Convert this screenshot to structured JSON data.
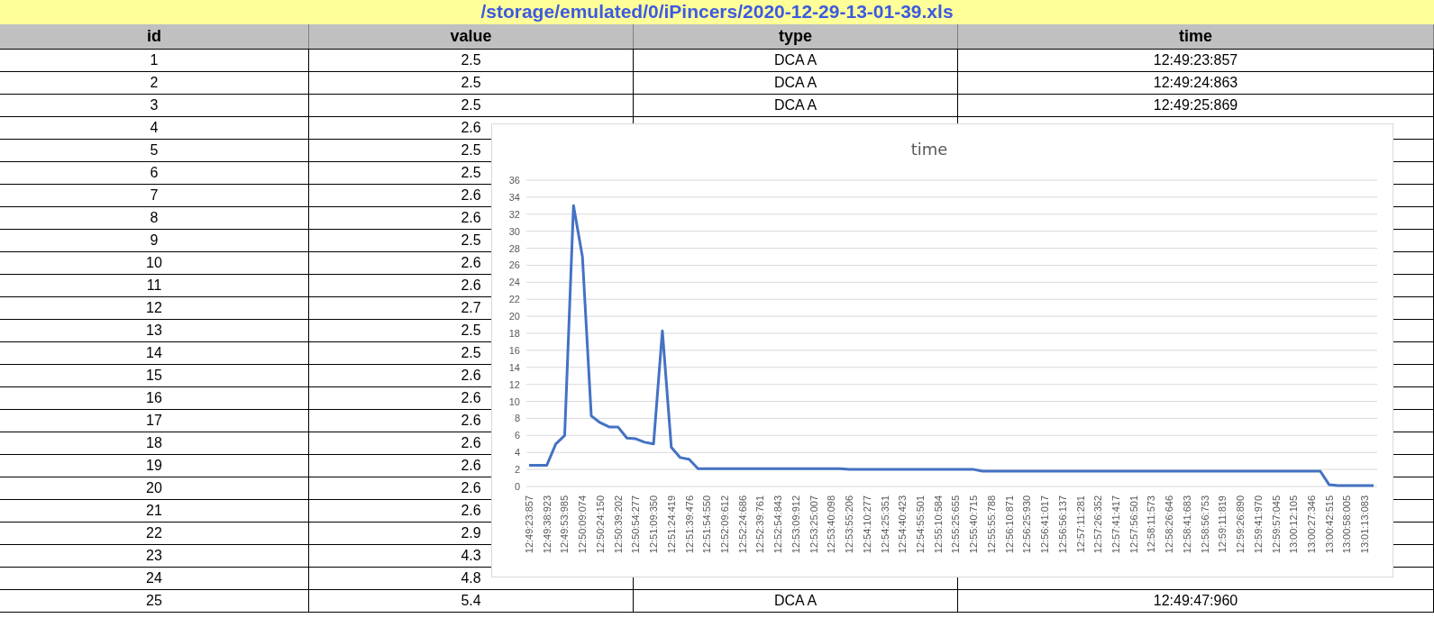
{
  "title": "/storage/emulated/0/iPincers/2020-12-29-13-01-39.xls",
  "table": {
    "columns": [
      "id",
      "value",
      "type",
      "time"
    ],
    "rows": [
      {
        "id": "1",
        "value": "2.5",
        "type": "DCA A",
        "time": "12:49:23:857"
      },
      {
        "id": "2",
        "value": "2.5",
        "type": "DCA A",
        "time": "12:49:24:863"
      },
      {
        "id": "3",
        "value": "2.5",
        "type": "DCA A",
        "time": "12:49:25:869"
      },
      {
        "id": "4",
        "value": "2.6"
      },
      {
        "id": "5",
        "value": "2.5"
      },
      {
        "id": "6",
        "value": "2.5"
      },
      {
        "id": "7",
        "value": "2.6"
      },
      {
        "id": "8",
        "value": "2.6"
      },
      {
        "id": "9",
        "value": "2.5"
      },
      {
        "id": "10",
        "value": "2.6"
      },
      {
        "id": "11",
        "value": "2.6"
      },
      {
        "id": "12",
        "value": "2.7"
      },
      {
        "id": "13",
        "value": "2.5"
      },
      {
        "id": "14",
        "value": "2.5"
      },
      {
        "id": "15",
        "value": "2.6"
      },
      {
        "id": "16",
        "value": "2.6"
      },
      {
        "id": "17",
        "value": "2.6"
      },
      {
        "id": "18",
        "value": "2.6"
      },
      {
        "id": "19",
        "value": "2.6"
      },
      {
        "id": "20",
        "value": "2.6"
      },
      {
        "id": "21",
        "value": "2.6"
      },
      {
        "id": "22",
        "value": "2.9"
      },
      {
        "id": "23",
        "value": "4.3"
      },
      {
        "id": "24",
        "value": "4.8"
      },
      {
        "id": "25",
        "value": "5.4",
        "type": "DCA A",
        "time": "12:49:47:960"
      }
    ]
  },
  "chart": {
    "chart_data": {
      "type": "line",
      "title": "time",
      "categories": [
        "12:49:23:857",
        null,
        "12:49:38:923",
        null,
        "12:49:53:985",
        null,
        "12:50:09:074",
        null,
        "12:50:24:150",
        null,
        "12:50:39:202",
        null,
        "12:50:54:277",
        null,
        "12:51:09:350",
        null,
        "12:51:24:419",
        null,
        "12:51:39:476",
        null,
        "12:51:54:550",
        null,
        "12:52:09:612",
        null,
        "12:52:24:686",
        null,
        "12:52:39:761",
        null,
        "12:52:54:843",
        null,
        "12:53:09:912",
        null,
        "12:53:25:007",
        null,
        "12:53:40:098",
        null,
        "12:53:55:206",
        null,
        "12:54:10:277",
        null,
        "12:54:25:351",
        null,
        "12:54:40:423",
        null,
        "12:54:55:501",
        null,
        "12:55:10:584",
        null,
        "12:55:25:655",
        null,
        "12:55:40:715",
        null,
        "12:55:55:788",
        null,
        "12:56:10:871",
        null,
        "12:56:25:930",
        null,
        "12:56:41:017",
        null,
        "12:56:56:137",
        null,
        "12:57:11:281",
        null,
        "12:57:26:352",
        null,
        "12:57:41:417",
        null,
        "12:57:56:501",
        null,
        "12:58:11:573",
        null,
        "12:58:26:646",
        null,
        "12:58:41:683",
        null,
        "12:58:56:753",
        null,
        "12:59:11:819",
        null,
        "12:59:26:890",
        null,
        "12:59:41:970",
        null,
        "12:59:57:045",
        null,
        "13:00:12:105",
        null,
        "13:00:27:346",
        null,
        "13:00:42:515",
        null,
        "13:00:58:005",
        null,
        "13:01:13:083",
        null
      ],
      "series": [
        {
          "color": "#4472c4",
          "values": [
            2.5,
            2.5,
            2.5,
            5,
            6,
            33,
            27,
            8.3,
            7.5,
            7,
            7,
            5.7,
            5.6,
            5.2,
            5,
            18.3,
            4.6,
            3.4,
            3.2,
            2.1,
            2.1,
            2.1,
            2.1,
            2.1,
            2.1,
            2.1,
            2.1,
            2.1,
            2.1,
            2.1,
            2.1,
            2.1,
            2.1,
            2.1,
            2.1,
            2.1,
            2.0,
            2.0,
            2.0,
            2.0,
            2.0,
            2.0,
            2.0,
            2.0,
            2.0,
            2.0,
            2.0,
            2.0,
            2.0,
            2.0,
            2.0,
            1.8,
            1.8,
            1.8,
            1.8,
            1.8,
            1.8,
            1.8,
            1.8,
            1.8,
            1.8,
            1.8,
            1.8,
            1.8,
            1.8,
            1.8,
            1.8,
            1.8,
            1.8,
            1.8,
            1.8,
            1.8,
            1.8,
            1.8,
            1.8,
            1.8,
            1.8,
            1.8,
            1.8,
            1.8,
            1.8,
            1.8,
            1.8,
            1.8,
            1.8,
            1.8,
            1.8,
            1.8,
            1.8,
            1.8,
            0.2,
            0.1,
            0.1,
            0.1,
            0.1,
            0.1
          ]
        }
      ],
      "grid": true,
      "ylim": [
        0,
        36
      ],
      "yticks": [
        0,
        2,
        4,
        6,
        8,
        10,
        12,
        14,
        16,
        18,
        20,
        22,
        24,
        26,
        28,
        30,
        32,
        34,
        36
      ]
    }
  }
}
